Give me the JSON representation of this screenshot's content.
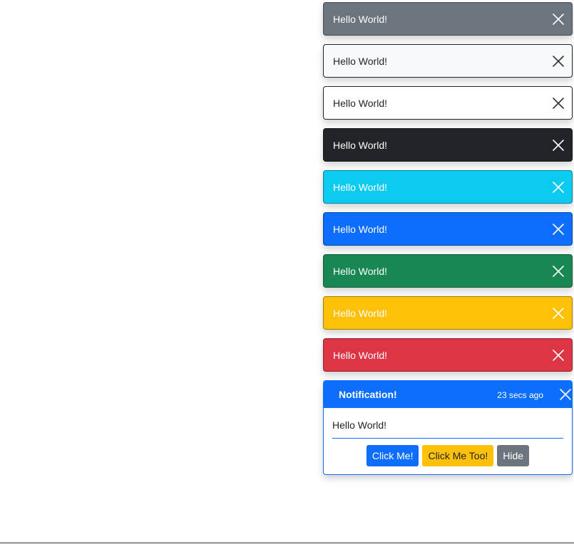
{
  "toasts": [
    {
      "variant": "secondary",
      "message": "Hello World!"
    },
    {
      "variant": "light",
      "message": "Hello World!"
    },
    {
      "variant": "white",
      "message": "Hello World!"
    },
    {
      "variant": "dark",
      "message": "Hello World!"
    },
    {
      "variant": "info",
      "message": "Hello World!"
    },
    {
      "variant": "primary",
      "message": "Hello World!"
    },
    {
      "variant": "success",
      "message": "Hello World!"
    },
    {
      "variant": "warning",
      "message": "Hello World!"
    },
    {
      "variant": "danger",
      "message": "Hello World!"
    }
  ],
  "notification": {
    "title": "Notification!",
    "time": "23 secs ago",
    "message": "Hello World!",
    "buttons": {
      "click_me": "Click Me!",
      "click_me_too": "Click Me Too!",
      "hide": "Hide"
    }
  },
  "colors": {
    "primary": "#0d6efd",
    "secondary": "#6c757d",
    "success": "#198754",
    "info": "#0dcaf0",
    "warning": "#ffc107",
    "danger": "#dc3545",
    "dark": "#212529",
    "light": "#f8f9fa"
  },
  "icons": {
    "close": "close-icon"
  }
}
